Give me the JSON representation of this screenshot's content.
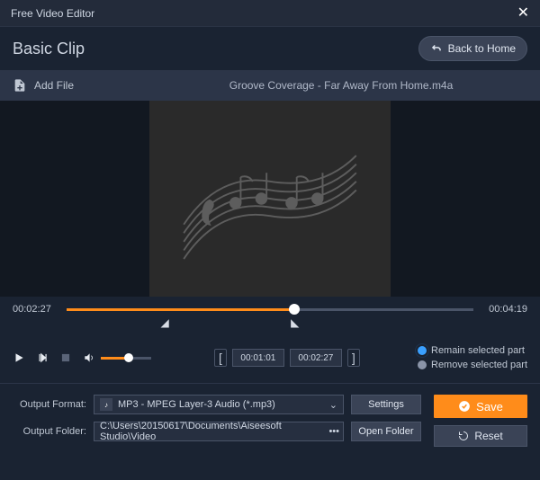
{
  "titlebar": {
    "app_name": "Free Video Editor"
  },
  "header": {
    "page_title": "Basic Clip",
    "back_home": "Back to Home"
  },
  "filebar": {
    "add_file": "Add File",
    "filename": "Groove Coverage - Far Away From Home.m4a"
  },
  "timeline": {
    "current": "00:02:27",
    "total": "00:04:19",
    "progress_pct": 56,
    "marker_start_pct": 24,
    "marker_end_pct": 56
  },
  "controls": {
    "volume_pct": 56,
    "clip_start": "00:01:01",
    "clip_end": "00:02:27",
    "radio_remain": "Remain selected part",
    "radio_remove": "Remove selected part",
    "radio_selected": "remain"
  },
  "output": {
    "format_label": "Output Format:",
    "format_value": "MP3 - MPEG Layer-3 Audio (*.mp3)",
    "settings_btn": "Settings",
    "folder_label": "Output Folder:",
    "folder_value": "C:\\Users\\20150617\\Documents\\Aiseesoft Studio\\Video",
    "open_folder_btn": "Open Folder",
    "save_btn": "Save",
    "reset_btn": "Reset"
  }
}
